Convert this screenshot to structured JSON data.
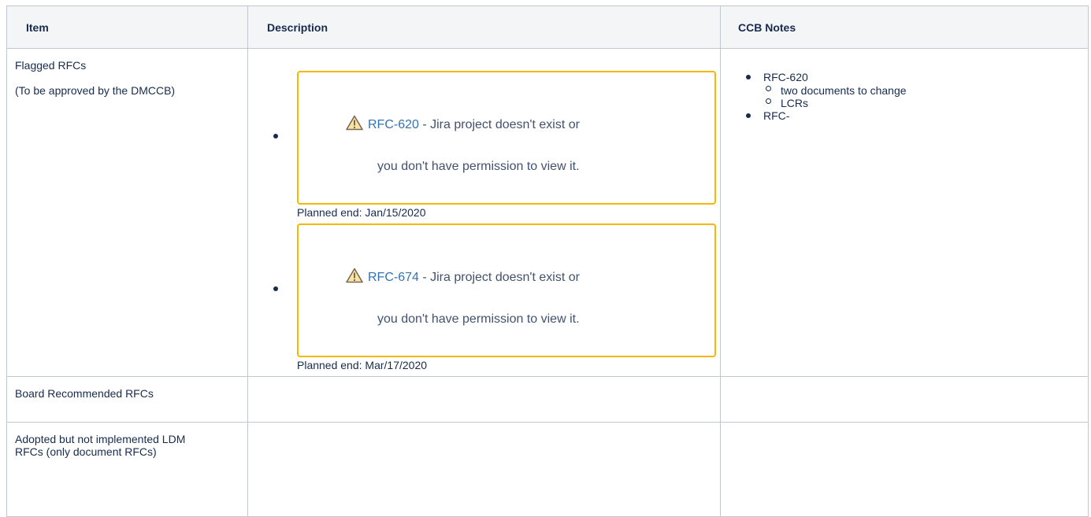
{
  "table": {
    "headers": {
      "item": "Item",
      "description": "Description",
      "notes": "CCB Notes"
    },
    "rows": [
      {
        "item_lines": [
          "Flagged RFCs",
          "(To be approved by the DMCCB)"
        ],
        "issues": [
          {
            "key": "RFC-620",
            "message_part1": " - Jira project doesn't exist or",
            "message_part2": "you don't have permission to view it.",
            "planned_end": "Planned end: Jan/15/2020"
          },
          {
            "key": "RFC-674",
            "message_part1": " - Jira project doesn't exist or",
            "message_part2": "you don't have permission to view it.",
            "planned_end": "Planned end: Mar/17/2020"
          }
        ],
        "notes": [
          {
            "text": "RFC-620",
            "sub": [
              "two documents to change",
              "LCRs"
            ]
          },
          {
            "text": "RFC-",
            "sub": []
          }
        ]
      },
      {
        "item_lines": [
          "Board Recommended RFCs"
        ]
      },
      {
        "item_lines": [
          "Adopted but not implemented LDM RFCs (only document RFCs)"
        ]
      }
    ]
  },
  "colors": {
    "border": "#c1c7d0",
    "header_bg": "#f4f5f7",
    "warning_border": "#f5b700",
    "link": "#3572b0",
    "text": "#172b4d"
  },
  "icons": {
    "warning": "warning-triangle-icon",
    "bullet": "bullet-icon"
  }
}
